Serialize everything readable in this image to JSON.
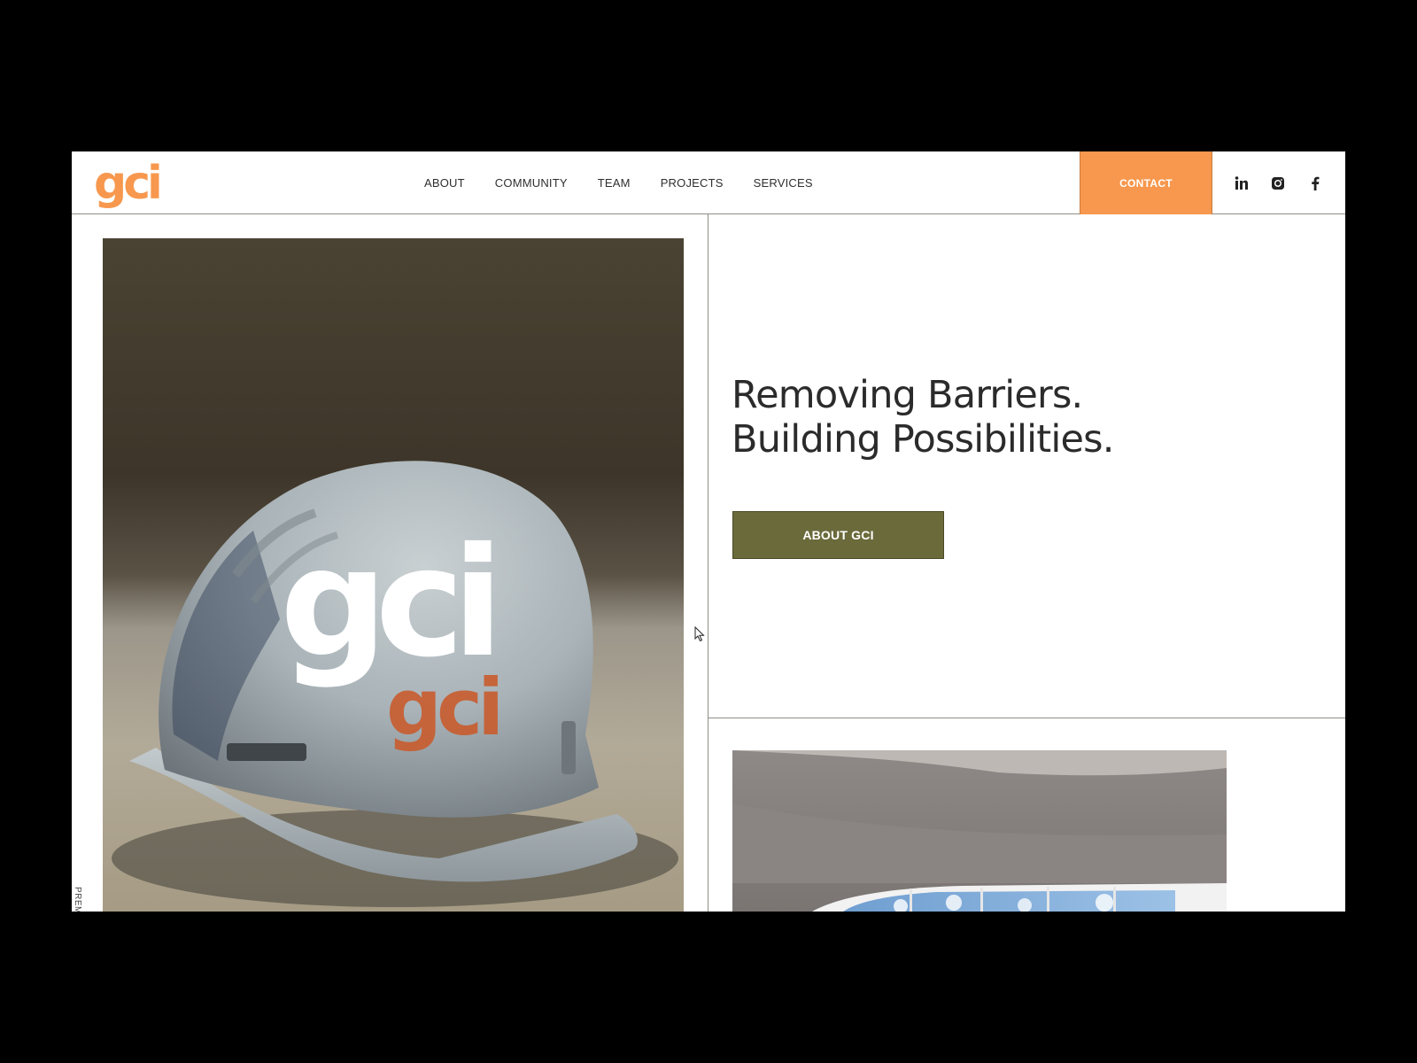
{
  "header": {
    "logo_text": "gci",
    "nav": [
      {
        "label": "ABOUT"
      },
      {
        "label": "COMMUNITY"
      },
      {
        "label": "TEAM"
      },
      {
        "label": "PROJECTS"
      },
      {
        "label": "SERVICES"
      }
    ],
    "contact_label": "CONTACT",
    "social": [
      "linkedin-icon",
      "instagram-icon",
      "facebook-icon"
    ]
  },
  "hero": {
    "image_logo_text": "gci",
    "helmet_print_text": "gci",
    "vertical_tag": "PREM",
    "headline_line1": "Removing Barriers.",
    "headline_line2": "Building Possibilities.",
    "button_label": "ABOUT GCI"
  },
  "colors": {
    "brand_orange": "#f7984e",
    "olive_button": "#6a6a3b",
    "headline_text": "#2b2b2b",
    "divider": "#8f8f86"
  }
}
